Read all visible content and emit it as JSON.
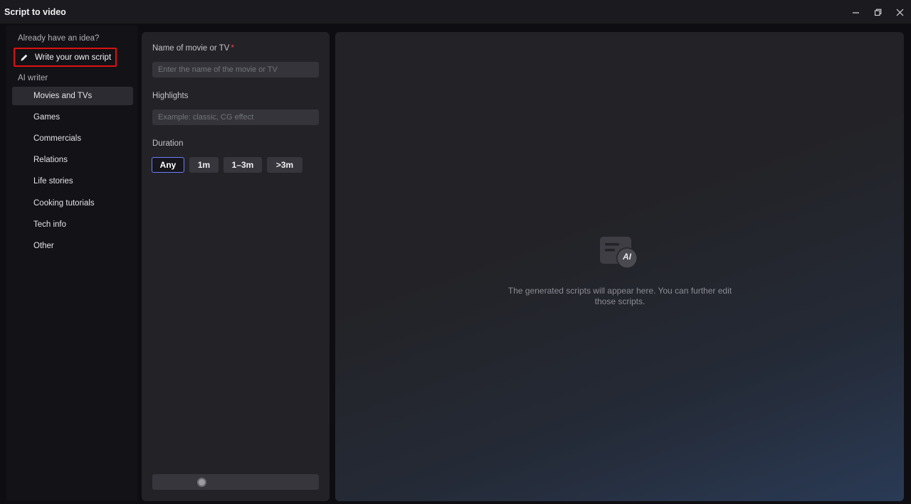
{
  "window": {
    "title": "Script to video",
    "minimize_label": "Minimize",
    "restore_label": "Restore",
    "close_label": "Close"
  },
  "sidebar": {
    "already_label": "Already have an idea?",
    "write_own_label": "Write your own script",
    "ai_writer_label": "AI writer",
    "items": [
      {
        "label": "Movies and TVs",
        "active": true
      },
      {
        "label": "Games"
      },
      {
        "label": "Commercials"
      },
      {
        "label": "Relations"
      },
      {
        "label": "Life stories"
      },
      {
        "label": "Cooking tutorials"
      },
      {
        "label": "Tech info"
      },
      {
        "label": "Other"
      }
    ]
  },
  "form": {
    "name_label": "Name of movie or TV",
    "required_mark": "*",
    "name_placeholder": "Enter the name of the movie or TV",
    "name_value": "",
    "highlights_label": "Highlights",
    "highlights_placeholder": "Example: classic, CG effect",
    "highlights_value": "",
    "duration_label": "Duration",
    "durations": [
      {
        "label": "Any",
        "selected": true
      },
      {
        "label": "1m"
      },
      {
        "label": "1–3m"
      },
      {
        "label": ">3m"
      }
    ]
  },
  "preview": {
    "icon": "ai-script-icon",
    "icon_text": "AI",
    "empty_message": "The generated scripts will appear here. You can further edit those scripts."
  },
  "colors": {
    "accent": "#6f7cff",
    "required": "#ff3b3b",
    "highlight_box": "#e01010"
  }
}
